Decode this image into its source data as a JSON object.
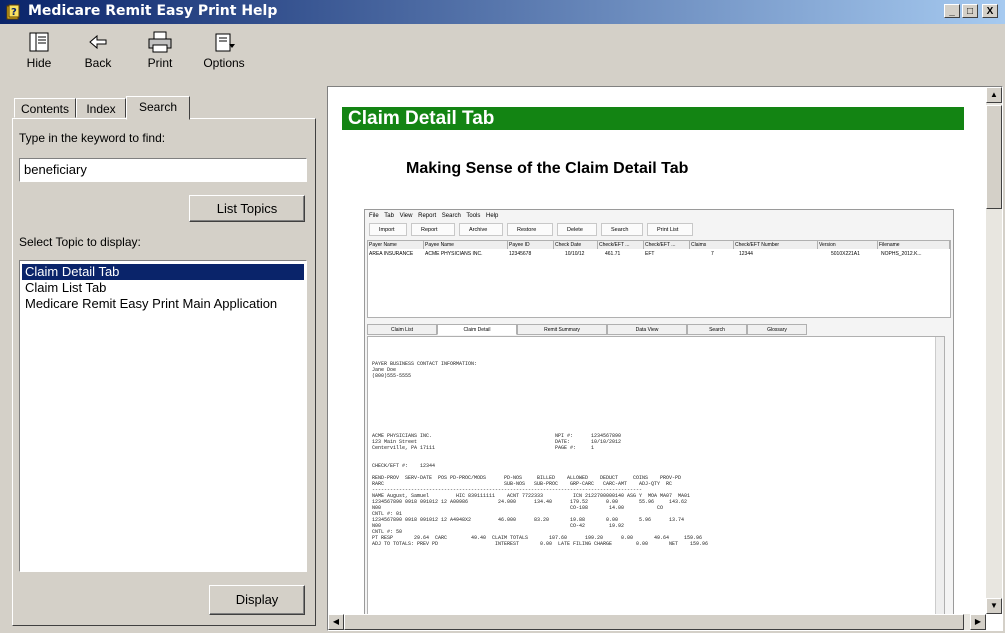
{
  "window": {
    "title": "Medicare Remit Easy Print Help",
    "min": "_",
    "max": "□",
    "close": "X"
  },
  "toolbar": {
    "hide": "Hide",
    "back": "Back",
    "print": "Print",
    "options": "Options"
  },
  "tabs": {
    "contents": "Contents",
    "index": "Index",
    "search": "Search"
  },
  "search": {
    "keyword_label": "Type in the keyword to find:",
    "keyword_value": "beneficiary",
    "list_topics": "List Topics",
    "select_label": "Select Topic to display:",
    "topics": [
      "Claim Detail Tab",
      "Claim List Tab",
      "Medicare Remit Easy Print Main Application"
    ],
    "display": "Display"
  },
  "content": {
    "banner": "Claim Detail Tab",
    "subheading": "Making Sense of the Claim Detail Tab"
  },
  "screenshot": {
    "menu": "File Tab View Report Search Tools Help",
    "toolbar": [
      "Import",
      "Report",
      "Archive",
      "Restore",
      "Delete",
      "Search",
      "Print List"
    ],
    "columns": [
      "Payer Name",
      "Payee Name",
      "Payee ID",
      "Check Date",
      "Check/EFT ...",
      "Check/EFT ...",
      "Claims",
      "Check/EFT Number",
      "Version",
      "Filename"
    ],
    "row": [
      "AREA INSURANCE",
      "ACME PHYSICIANS INC.",
      "12345678",
      "10/10/12",
      "461.71",
      "EFT",
      "7",
      "12344",
      "5010X221A1",
      "NOPHS_2012.K..."
    ],
    "tabs": [
      "Claim List",
      "Claim Detail",
      "Remit Summary",
      "Data View",
      "Search",
      "Glossary"
    ],
    "doc_lines": [
      "PAYER BUSINESS CONTACT INFORMATION:",
      "Jane Doe",
      "(800)555-5555",
      "",
      "",
      "",
      "",
      "",
      "",
      "",
      "",
      "",
      "ACME PHYSICIANS INC.                                         NPI #:      1234567890",
      "123 Main Street                                              DATE:       10/10/2012",
      "Centerville, PA 17111                                        PAGE #:     1",
      "",
      "",
      "CHECK/EFT #:    12344",
      "",
      "REND-PROV  SERV-DATE  POS PD-PROC/MODS      PD-NOS     BILLED    ALLOWED    DEDUCT     COINS    PROV-PD",
      "RARC                                        SUB-NOS   SUB-PROC    GRP-CARC   CARC-AMT    ADJ-QTY  RC",
      "------------------------------------------------------------------------------------------",
      "NAME August, Samuel         HIC 839111111    ACNT 7722333          ICN 2122700000140 ASG Y  MOA MA07  MA01",
      "1234567890 0918 091012 12 A00986          24.000      134.40      179.52      0.00       55.96     143.62",
      "N00                                                               CO-108       14.00           CO",
      "CNTL #: 01",
      "1234567890 0918 091012 12 A4948X2         46.000      83.20       19.88       0.00       5.96      13.74",
      "N00                                                               CO-42        19.92",
      "CNTL #: 50",
      "PT RESP       29.64  CARC        49.40  CLAIM TOTALS       107.60      199.20      0.00       49.64     159.96",
      "ADJ TO TOTALS: PREV PD                   INTEREST       0.00  LATE FILING CHARGE        0.00       NET    159.96"
    ]
  }
}
